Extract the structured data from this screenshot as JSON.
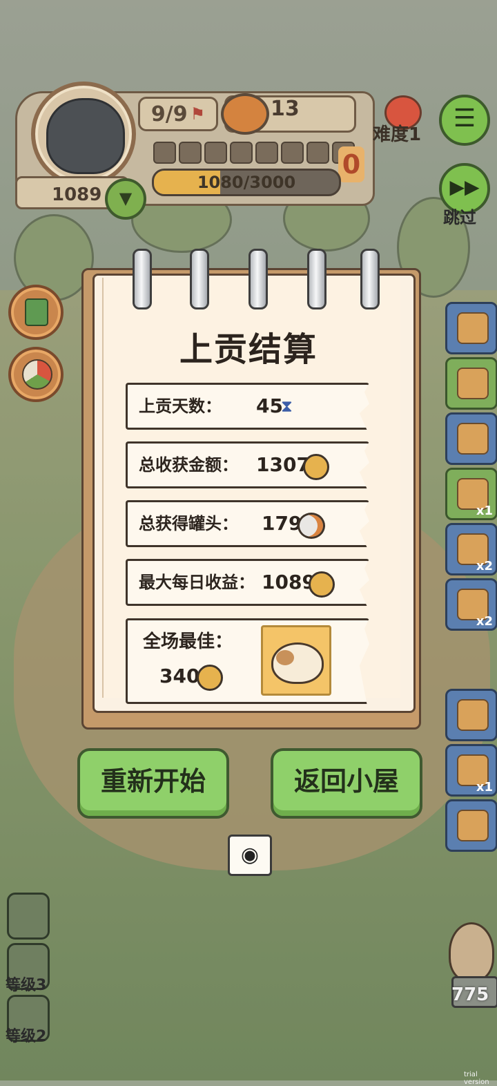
{
  "hud": {
    "flags": "9/9",
    "flag_icon": "flag-icon",
    "cans": "13",
    "coins": "1089",
    "xp_text": "1080/3000",
    "xp_progress": 0.36,
    "zero_badge": "0",
    "segments": 8,
    "difficulty": "难度1",
    "skip": "跳过"
  },
  "dialog": {
    "title": "上贡结算",
    "rows": [
      {
        "label": "上贡天数：",
        "value": "45",
        "icon": "hourglass-icon"
      },
      {
        "label": "总收获金额：",
        "value": "1307",
        "icon": "paw-coin-icon"
      },
      {
        "label": "总获得罐头：",
        "value": "179",
        "icon": "can-icon"
      },
      {
        "label": "最大每日收益：",
        "value": "1089",
        "icon": "paw-coin-icon"
      }
    ],
    "best": {
      "label": "全场最佳：",
      "value": "340",
      "icon": "paw-coin-icon",
      "pet": "hamster"
    }
  },
  "buttons": {
    "restart": "重新开始",
    "back_home": "返回小屋"
  },
  "left_levels": [
    {
      "label": "等级3"
    },
    {
      "label": "等级2"
    }
  ],
  "right_items": [
    {
      "icon": "trophy-icon",
      "sub": ""
    },
    {
      "icon": "ticket-icon",
      "sub": ""
    },
    {
      "icon": "cage-icon",
      "sub": ""
    },
    {
      "icon": "mole-icon",
      "sub": "x1"
    },
    {
      "icon": "glove-icon",
      "sub": "x2"
    },
    {
      "icon": "shovel-icon",
      "sub": "x2"
    },
    {
      "icon": "card-icon",
      "sub": ""
    },
    {
      "icon": "peanut-icon",
      "sub": "x1"
    },
    {
      "icon": "wind-up-toy-icon",
      "sub": ""
    }
  ],
  "mole_count": "775",
  "watermark": "trial version"
}
